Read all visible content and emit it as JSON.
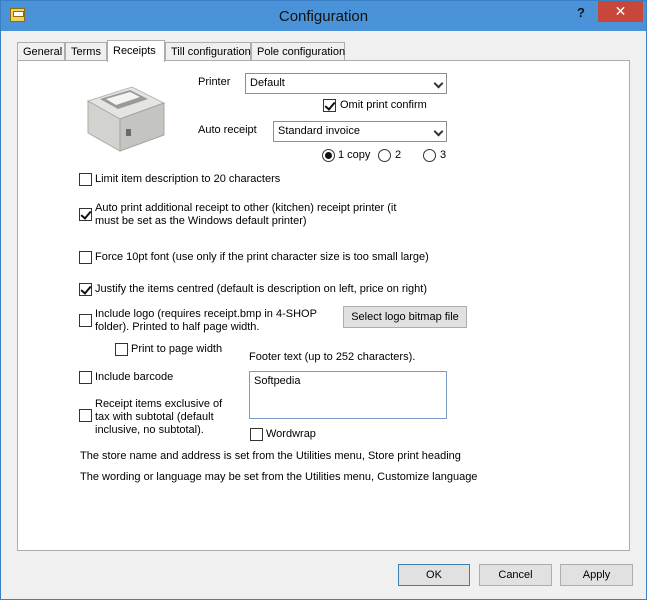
{
  "window": {
    "title": "Configuration",
    "help_label": "?",
    "close_label": "✕"
  },
  "tabs": [
    {
      "label": "General"
    },
    {
      "label": "Terms"
    },
    {
      "label": "Receipts",
      "active": true
    },
    {
      "label": "Till configuration"
    },
    {
      "label": "Pole configuration"
    }
  ],
  "receipts": {
    "printer_label": "Printer",
    "printer_value": "Default",
    "omit_confirm_label": "Omit print confirm",
    "omit_confirm_checked": true,
    "auto_receipt_label": "Auto receipt",
    "auto_receipt_value": "Standard invoice",
    "copies": [
      {
        "label": "1 copy",
        "selected": true
      },
      {
        "label": "2",
        "selected": false
      },
      {
        "label": "3",
        "selected": false
      }
    ],
    "limit_desc_label": "Limit item description to 20 characters",
    "limit_desc_checked": false,
    "auto_print_label_1": "Auto print additional receipt to other (kitchen) receipt printer (it",
    "auto_print_label_2": "must be set as the Windows default printer)",
    "auto_print_checked": true,
    "force_font_label": "Force 10pt font (use only if the print character size is too small large)",
    "force_font_checked": false,
    "justify_label": "Justify the items centred (default is description on left, price on right)",
    "justify_checked": true,
    "include_logo_label_1": "Include logo (requires receipt.bmp in 4-SHOP",
    "include_logo_label_2": "folder). Printed to half page width.",
    "include_logo_checked": false,
    "select_logo_button": "Select logo bitmap file",
    "print_page_width_label": "Print to page width",
    "print_page_width_checked": false,
    "footer_label": "Footer text (up to 252 characters).",
    "footer_value": "Softpedia",
    "include_barcode_label": "Include barcode",
    "include_barcode_checked": false,
    "exclusive_tax_label_1": "Receipt items exclusive of",
    "exclusive_tax_label_2": "tax with subtotal (default",
    "exclusive_tax_label_3": "inclusive, no subtotal).",
    "exclusive_tax_checked": false,
    "wordwrap_label": "Wordwrap",
    "wordwrap_checked": false,
    "store_info_text": "The store name and address is set from the Utilities menu, Store print heading",
    "wording_info_text": "The wording or language may be set from the Utilities menu, Customize language"
  },
  "footer_buttons": {
    "ok": "OK",
    "cancel": "Cancel",
    "apply": "Apply"
  }
}
